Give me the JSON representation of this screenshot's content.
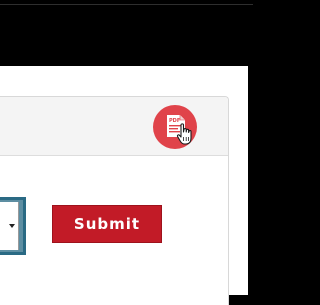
{
  "colors": {
    "background": "#000000",
    "panel_header": "#f4f4f4",
    "pdf_button": "#e0434a",
    "submit_button": "#c21b27",
    "select_border": "#2a6a84"
  },
  "toolbar": {
    "pdf_icon": "pdf-file-icon",
    "pdf_icon_text": "PDF",
    "cursor_icon": "hand-pointer-icon"
  },
  "form": {
    "select_icon": "dropdown-arrow-icon",
    "submit_label": "Submit"
  }
}
